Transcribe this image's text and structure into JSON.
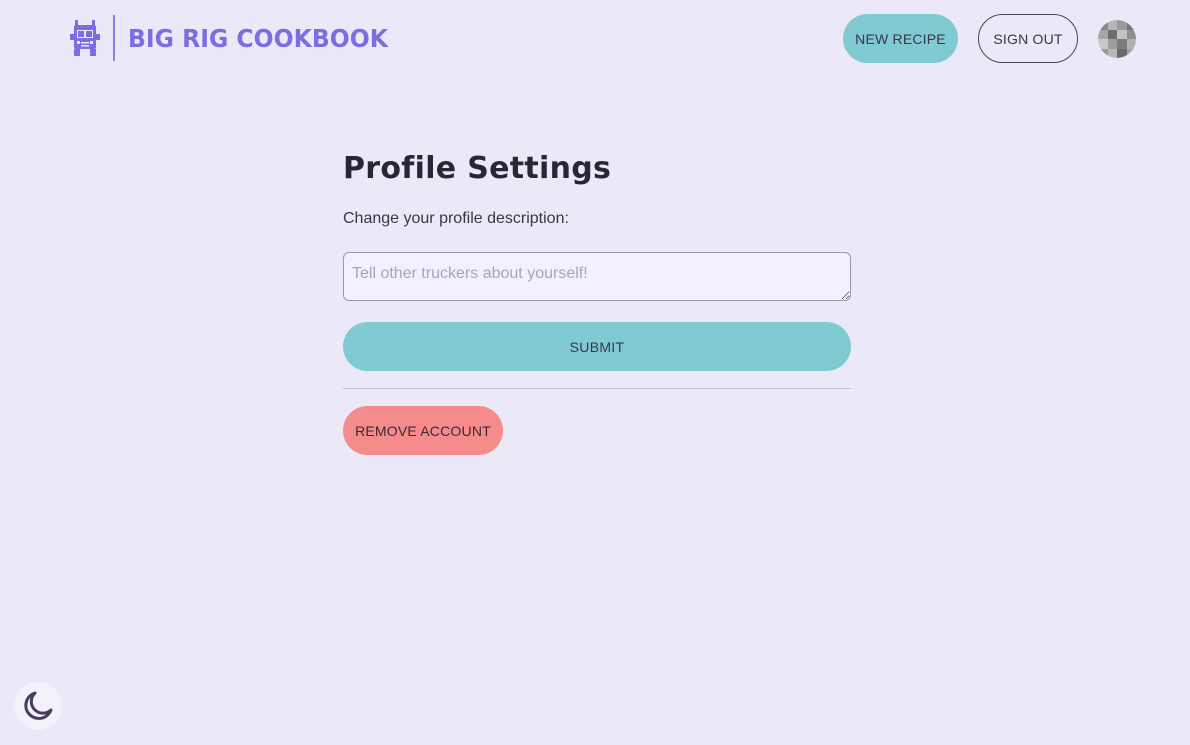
{
  "header": {
    "brand_name": "BIG RIG COOKBOOK",
    "logo_icon": "truck-icon",
    "new_recipe_label": "NEW RECIPE",
    "sign_out_label": "SIGN OUT",
    "avatar_icon": "user-avatar"
  },
  "main": {
    "title": "Profile Settings",
    "description_label": "Change your profile description:",
    "description_placeholder": "Tell other truckers about yourself!",
    "description_value": "",
    "submit_label": "SUBMIT",
    "remove_account_label": "REMOVE ACCOUNT"
  },
  "theme_toggle": {
    "icon": "moon-icon"
  },
  "colors": {
    "background": "#ebe9f7",
    "brand": "#7c6ee0",
    "primary_button": "#7fcbd1",
    "danger_button": "#f58b8b",
    "text": "#3a3548"
  }
}
